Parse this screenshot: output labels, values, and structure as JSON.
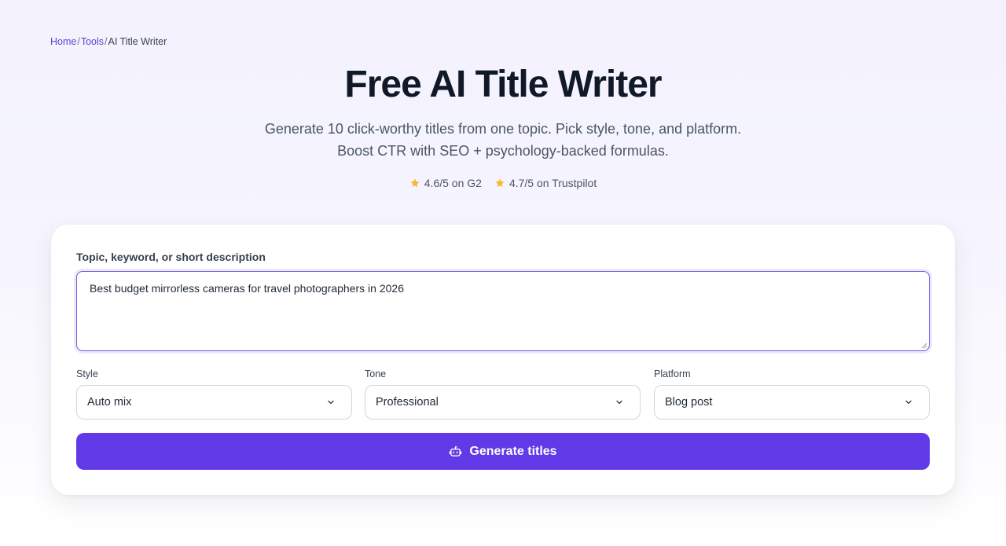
{
  "breadcrumb": {
    "items": [
      {
        "label": "Home"
      },
      {
        "label": "Tools"
      },
      {
        "label": "AI Title Writer"
      }
    ],
    "separator": "/"
  },
  "hero": {
    "title": "Free AI Title Writer",
    "subtitle_line1": "Generate 10 click-worthy titles from one topic. Pick style, tone, and platform.",
    "subtitle_line2": "Boost CTR with SEO + psychology-backed formulas."
  },
  "ratings": [
    {
      "icon": "star-icon",
      "text": "4.6/5 on G2"
    },
    {
      "icon": "star-icon",
      "text": "4.7/5 on Trustpilot"
    }
  ],
  "form": {
    "topic_label": "Topic, keyword, or short description",
    "topic_value": "Best budget mirrorless cameras for travel photographers in 2026",
    "style": {
      "label": "Style",
      "value": "Auto mix"
    },
    "tone": {
      "label": "Tone",
      "value": "Professional"
    },
    "platform": {
      "label": "Platform",
      "value": "Blog post"
    },
    "generate_label": "Generate titles"
  },
  "colors": {
    "accent": "#6139e6",
    "link": "#5b43d6",
    "star": "#f5b82e"
  }
}
